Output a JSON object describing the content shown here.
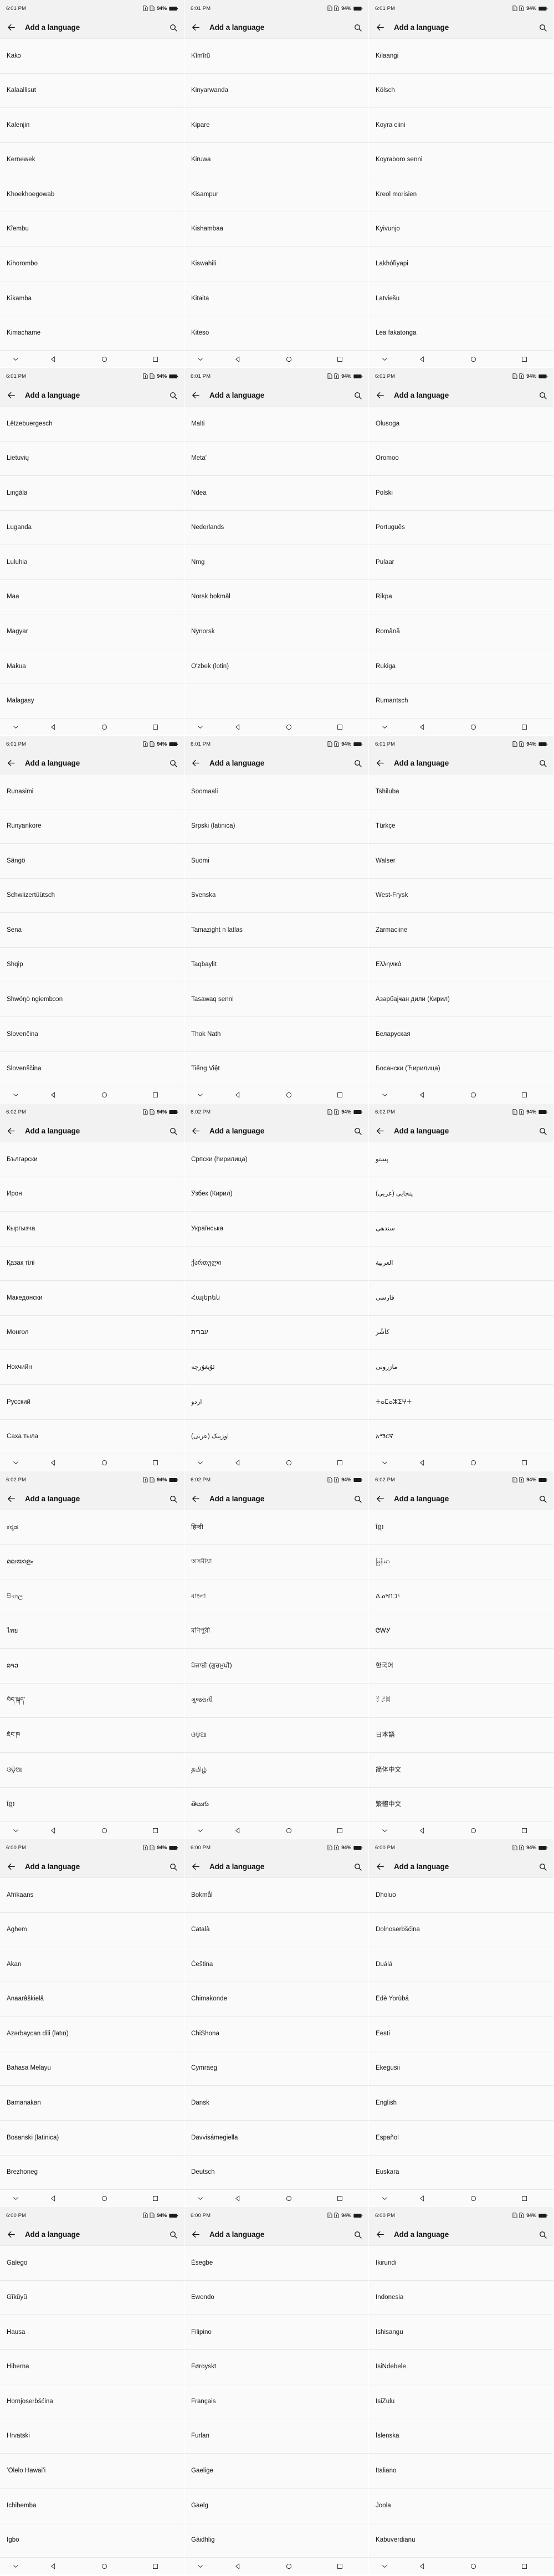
{
  "app": {
    "title": "Add a language",
    "back_icon": "back-arrow-icon",
    "search_icon": "search-icon"
  },
  "status_bar": {
    "battery_percent": "94%",
    "sim1_icon": "sim-card-alert-icon",
    "sim2_icon": "sim-card-alert-icon",
    "battery_icon": "battery-full-icon"
  },
  "nav_bar": {
    "hide_icon": "chevron-down-icon",
    "back_icon": "triangle-back-icon",
    "home_icon": "circle-home-icon",
    "recents_icon": "square-recents-icon"
  },
  "panels": [
    {
      "time": "6:01 PM",
      "languages": [
        "Kakɔ",
        "Kalaallisut",
        "Kalenjin",
        "Kernewek",
        "Khoekhoegowab",
        "Kĩembu",
        "Kihorombo",
        "Kikamba",
        "Kimachame"
      ]
    },
    {
      "time": "6:01 PM",
      "languages": [
        "Kĩmĩrũ",
        "Kinyarwanda",
        "Kipare",
        "Kiruwa",
        "Kisampur",
        "Kishambaa",
        "Kiswahili",
        "Kitaita",
        "Kiteso"
      ]
    },
    {
      "time": "6:01 PM",
      "languages": [
        "Kɨlaangi",
        "Kölsch",
        "Koyra ciini",
        "Koyraboro senni",
        "Kreol morisien",
        "Kyivunjo",
        "Lakȟóľiyapi",
        "Latviešu",
        "Lea fakatonga"
      ]
    },
    {
      "time": "6:01 PM",
      "languages": [
        "Lëtzebuergesch",
        "Lietuvių",
        "Lingála",
        "Luganda",
        "Luluhia",
        "Maa",
        "Magyar",
        "Makua",
        "Malagasy"
      ]
    },
    {
      "time": "6:01 PM",
      "languages": [
        "Malti",
        "Meta'",
        "Ndea",
        "Nederlands",
        "Nmg",
        "Norsk bokmål",
        "Nynorsk",
        "O'zbek (lotin)",
        ""
      ]
    },
    {
      "time": "6:01 PM",
      "languages": [
        "Olusoga",
        "Oromoo",
        "Polski",
        "Português",
        "Pulaar",
        "Rikpa",
        "Română",
        "Rukiga",
        "Rumantsch"
      ]
    },
    {
      "time": "6:01 PM",
      "languages": [
        "Runasimi",
        "Runyankore",
        "Sängö",
        "Schwiizertüütsch",
        "Sena",
        "Shqip",
        "Shwóŋò ngiembɔɔn",
        "Slovenčina",
        "Slovenščina"
      ]
    },
    {
      "time": "6:01 PM",
      "languages": [
        "Soomaali",
        "Srpski (latinica)",
        "Suomi",
        "Svenska",
        "Tamazight n latlas",
        "Taqbaylit",
        "Tasawaq senni",
        "Thok Nath",
        "Tiếng Việt"
      ]
    },
    {
      "time": "6:01 PM",
      "languages": [
        "Tshiluba",
        "Türkçe",
        "Walser",
        "West-Frysk",
        "Zarmaciine",
        "Ελληνικά",
        "Азәрбајҹан дили (Кирил)",
        "Беларуская",
        "Босански (Ћирилица)"
      ]
    },
    {
      "time": "6:02 PM",
      "languages": [
        "Български",
        "Ирон",
        "Кыргызча",
        "Қазақ тілі",
        "Македонски",
        "Монгол",
        "Нохчийн",
        "Русский",
        "Саха тыла"
      ]
    },
    {
      "time": "6:02 PM",
      "languages": [
        "Српски (ћирилица)",
        "Ўзбек (Кирил)",
        "Українська",
        "ქართული",
        "Հայերեն",
        "עברית",
        "ئۇيغۇرچە",
        "اردو",
        "اوزبیک (عربی)"
      ]
    },
    {
      "time": "6:02 PM",
      "languages": [
        "پښتو",
        "پنجابی (عربی)",
        "سندھی",
        "العربية",
        "فارسی",
        "كأشُر",
        "مازرونی",
        "ⵜⴰⵎⴰⵣⵉⵖⵜ",
        "አማርኛ"
      ]
    },
    {
      "time": "6:02 PM",
      "languages": [
        "ಕನ್ನಡ",
        "മലയാളം",
        "සිංහල",
        "ไทย",
        "ລາວ",
        "བོད་སྐད་",
        "ཇོང་ཁ",
        "ଓଡ଼ିଆ",
        "ខ្មែរ"
      ]
    },
    {
      "time": "6:02 PM",
      "languages": [
        "हिन्दी",
        "অসমীয়া",
        "বাংলা",
        "মণিপুরী",
        "ਪੰਜਾਬੀ (ਗੁਰਮੁਖੀ)",
        "ગુજરાતી",
        "ଓଡ଼ିଆ",
        "தமிழ்",
        "తెలుగు"
      ]
    },
    {
      "time": "6:02 PM",
      "languages": [
        "ខ្មែរ",
        "မြန်မာ",
        "ᐃᓄᒃᑎᑐᑦ",
        "ᏣᎳᎩ",
        "한국어",
        "ꆈꌠꉙ",
        "日本語",
        "简体中文",
        "繁體中文"
      ]
    },
    {
      "time": "6:00 PM",
      "languages": [
        "Afrikaans",
        "Aghem",
        "Akan",
        "Anaarâškielâ",
        "Azərbaycan dili (latın)",
        "Bahasa Melayu",
        "Bamanakan",
        "Bosanski (latinica)",
        "Brezhoneg"
      ]
    },
    {
      "time": "6:00 PM",
      "languages": [
        "Bokmål",
        "Català",
        "Čeština",
        "Chimakonde",
        "ChiShona",
        "Cymraeg",
        "Dansk",
        "Davvisámegiella",
        "Deutsch"
      ]
    },
    {
      "time": "6:00 PM",
      "languages": [
        "Dholuo",
        "Dolnoserbšćina",
        "Duálá",
        "Èdè Yorùbá",
        "Eesti",
        "Ekegusii",
        "English",
        "Español",
        "Euskara"
      ]
    },
    {
      "time": "6:00 PM",
      "languages": [
        "Galego",
        "Gĩkũyũ",
        "Hausa",
        "Hiberna",
        "Hornjoserbšćina",
        "Hrvatski",
        "ʻŌlelo Hawaiʻi",
        "Ichibemba",
        "Igbo"
      ]
    },
    {
      "time": "6:00 PM",
      "languages": [
        "Ésegbe",
        "Ewondo",
        "Filipino",
        "Føroyskt",
        "Français",
        "Furlan",
        "Gaelige",
        "Gaelg",
        "Gàidhlig"
      ]
    },
    {
      "time": "6:00 PM",
      "languages": [
        "Ikirundi",
        "Indonesia",
        "Ishisangu",
        "IsiNdebele",
        "IsiZulu",
        "Íslenska",
        "Italiano",
        "Joola",
        "Kabuverdianu"
      ]
    }
  ]
}
